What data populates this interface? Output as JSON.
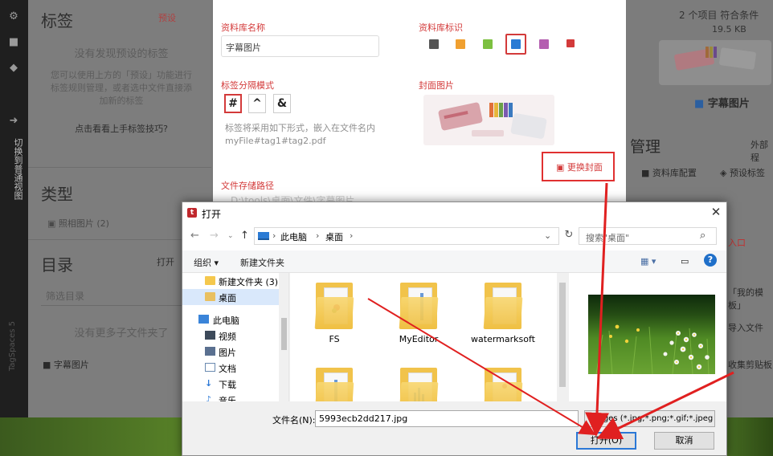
{
  "app": {
    "rail": {
      "vertical_label": "切换到普通视图",
      "version": "TagSpaces 5"
    },
    "left_panel": {
      "tags": {
        "title": "标签",
        "preset": "预设",
        "no_tags": "没有发现预设的标签",
        "help_text": "您可以使用上方的「预设」功能进行标签规则管理，或者选中文件直接添加新的标签",
        "tip": "点击看看上手标签技巧?"
      },
      "types": {
        "title": "类型",
        "item": "照相图片",
        "item_count": "(2)"
      },
      "directory": {
        "title": "目录",
        "open": "打开",
        "filter_placeholder": "筛选目录",
        "no_more": "没有更多子文件夹了",
        "item": "字幕图片"
      }
    },
    "right_panel": {
      "summary": "2 个项目 符合条件",
      "size": "19.5 KB",
      "library_name": "字幕图片",
      "manage_title": "管理",
      "external": "外部程",
      "library_config": "资料库配置",
      "preset_tags": "预设标签",
      "line_a": "入口",
      "line_b": "「我的模板」",
      "line_c": "导入文件",
      "line_d": "收集剪贴板"
    }
  },
  "library_dialog": {
    "name_label": "资料库名称",
    "name_value": "字幕图片",
    "icon_label": "资料库标识",
    "separator_label": "标签分隔模式",
    "separators": [
      "#",
      "^",
      "&"
    ],
    "separator_desc_1": "标签将采用如下形式，嵌入在文件名内",
    "separator_desc_2": "myFile#tag1#tag2.pdf",
    "cover_label": "封面图片",
    "change_cover": "更换封面",
    "path_label": "文件存储路径",
    "path_value": "D:\\tools\\桌面\\文件\\字幕图片",
    "icon_colors": [
      "#555555",
      "#f0a030",
      "#7cc040",
      "#2b7bd4",
      "#b45fb0",
      "#d33a3a"
    ]
  },
  "file_dialog": {
    "title": "打开",
    "breadcrumb": [
      "此电脑",
      "桌面"
    ],
    "search_placeholder": "搜索\"桌面\"",
    "toolbar": {
      "organize": "组织 ▾",
      "new_folder": "新建文件夹"
    },
    "tree": [
      {
        "label": "新建文件夹 (3)",
        "type": "folder"
      },
      {
        "label": "桌面",
        "type": "folder",
        "selected": true
      },
      {
        "label": "此电脑",
        "type": "pc"
      },
      {
        "label": "视频",
        "type": "video"
      },
      {
        "label": "图片",
        "type": "pictures"
      },
      {
        "label": "文档",
        "type": "docs"
      },
      {
        "label": "下载",
        "type": "download"
      },
      {
        "label": "音乐",
        "type": "music"
      }
    ],
    "files": [
      {
        "name": "FS"
      },
      {
        "name": "MyEditor"
      },
      {
        "name": "watermarksoft"
      }
    ],
    "filename_label": "文件名(N):",
    "filename_value": "5993ecb2dd217.jpg",
    "filetype": "Images (*.jpg;*.png;*.gif;*.jpeg",
    "open_button": "打开(O)",
    "cancel_button": "取消"
  },
  "colors": {
    "accent_red": "#e03030",
    "windows_blue": "#2b78d6"
  }
}
